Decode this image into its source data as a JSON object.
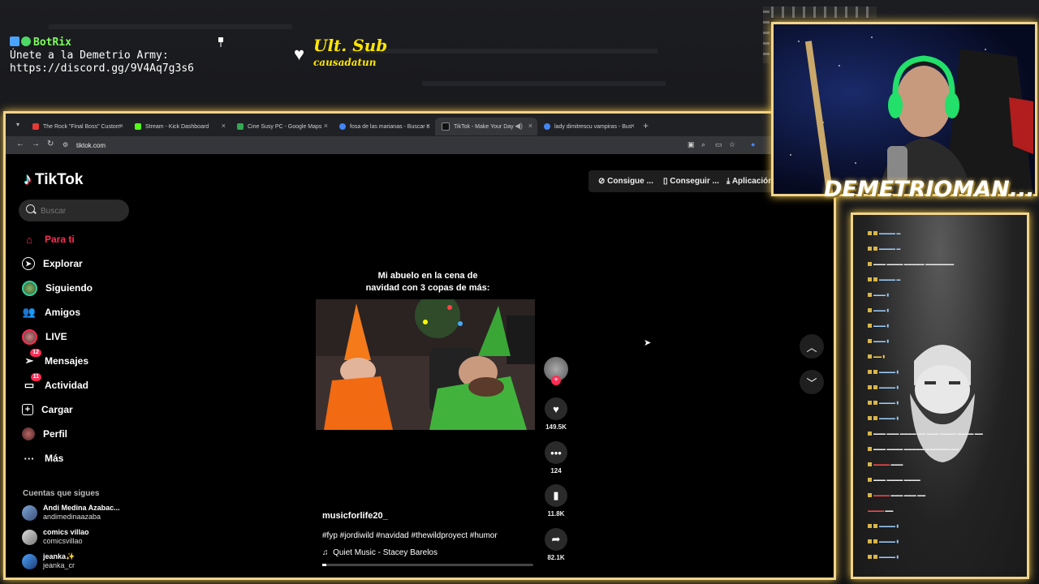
{
  "overlay": {
    "botrix_name": "BotRix",
    "botrix_line1": "Únete a la Demetrio Army:",
    "botrix_line2": "https://discord.gg/9V4Aq7g3s6",
    "ultsub_title": "Ult. Sub",
    "ultsub_user": "causadatun",
    "streamer_name": "DEMETRIOMAN..."
  },
  "browser": {
    "tabs": [
      {
        "label": "The Rock \"Final Boss\" Custom",
        "color": "#e53935"
      },
      {
        "label": "Stream - Kick Dashboard",
        "color": "#53fc18"
      },
      {
        "label": "Cine Susy PC - Google Maps",
        "color": "#34a853"
      },
      {
        "label": "fosa de las marianas - Buscar c",
        "color": "#4285f4"
      },
      {
        "label": "TikTok - Make Your Day",
        "color": "#111111"
      },
      {
        "label": "lady dimitrescu vampiras - Bus",
        "color": "#4285f4"
      }
    ],
    "url": "tiktok.com"
  },
  "tiktok": {
    "logo": "TikTok",
    "search_placeholder": "Buscar",
    "nav": [
      {
        "label": "Para ti",
        "badge": ""
      },
      {
        "label": "Explorar",
        "badge": ""
      },
      {
        "label": "Siguiendo",
        "badge": ""
      },
      {
        "label": "Amigos",
        "badge": ""
      },
      {
        "label": "LIVE",
        "badge": ""
      },
      {
        "label": "Mensajes",
        "badge": "12"
      },
      {
        "label": "Actividad",
        "badge": "11"
      },
      {
        "label": "Cargar",
        "badge": ""
      },
      {
        "label": "Perfil",
        "badge": ""
      },
      {
        "label": "Más",
        "badge": ""
      }
    ],
    "following_title": "Cuentas que sigues",
    "following": [
      {
        "name": "Andi Medina Azabac...",
        "handle": "andimedinaazaba"
      },
      {
        "name": "comics villao",
        "handle": "comicsvillao"
      },
      {
        "name": "jeanka✨",
        "handle": "jeanka_cr"
      }
    ],
    "top_buttons": [
      "Consigue ...",
      "Conseguir ...",
      "Aplicación"
    ],
    "video": {
      "caption_line1": "Mi abuelo en la cena de",
      "caption_line2": "navidad con 3 copas de más:",
      "author": "musicforlife20_",
      "tags": "#fyp #jordiwild #navidad #thewildproyect #humor",
      "music": "Quiet Music - Stacey Barelos",
      "progress": 0.02
    },
    "actions": {
      "likes": "149.5K",
      "comments": "124",
      "saves": "11.8K",
      "shares": "82.1K"
    }
  }
}
